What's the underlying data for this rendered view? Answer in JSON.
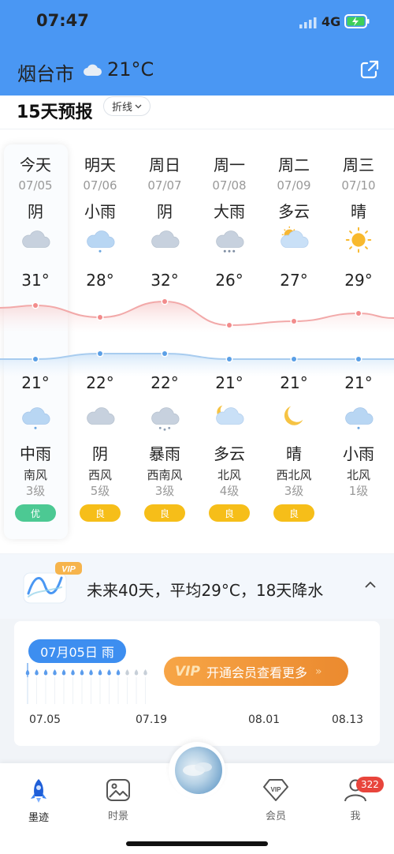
{
  "status_bar": {
    "time": "07:47",
    "network": "4G"
  },
  "header": {
    "city": "烟台市",
    "weather_icon": "cloud-icon",
    "temperature": "21°C"
  },
  "forecast": {
    "title": "15天预报",
    "view_toggle": "折线",
    "days": [
      {
        "day": "今天",
        "date": "07/05",
        "day_condition": "阴",
        "day_icon": "overcast",
        "high": "31°",
        "low": "21°",
        "night_icon": "rain",
        "night_condition": "中雨",
        "wind": "南风",
        "wind_level": "3级",
        "aqi": "优",
        "aqi_color": "#4cc993"
      },
      {
        "day": "明天",
        "date": "07/06",
        "day_condition": "小雨",
        "day_icon": "rain",
        "high": "28°",
        "low": "22°",
        "night_icon": "overcast",
        "night_condition": "阴",
        "wind": "西风",
        "wind_level": "5级",
        "aqi": "良",
        "aqi_color": "#f6be19"
      },
      {
        "day": "周日",
        "date": "07/07",
        "day_condition": "阴",
        "day_icon": "overcast",
        "high": "32°",
        "low": "22°",
        "night_icon": "rainstorm",
        "night_condition": "暴雨",
        "wind": "西南风",
        "wind_level": "3级",
        "aqi": "良",
        "aqi_color": "#f6be19"
      },
      {
        "day": "周一",
        "date": "07/08",
        "day_condition": "大雨",
        "day_icon": "heavy-rain",
        "high": "26°",
        "low": "21°",
        "night_icon": "moon-cloud",
        "night_condition": "多云",
        "wind": "北风",
        "wind_level": "4级",
        "aqi": "良",
        "aqi_color": "#f6be19"
      },
      {
        "day": "周二",
        "date": "07/09",
        "day_condition": "多云",
        "day_icon": "sun-cloud",
        "high": "27°",
        "low": "21°",
        "night_icon": "moon",
        "night_condition": "晴",
        "wind": "西北风",
        "wind_level": "3级",
        "aqi": "良",
        "aqi_color": "#f6be19"
      },
      {
        "day": "周三",
        "date": "07/10",
        "day_condition": "晴",
        "day_icon": "sun",
        "high": "29°",
        "low": "21°",
        "night_icon": "rain",
        "night_condition": "小雨",
        "wind": "北风",
        "wind_level": "1级",
        "aqi": "",
        "aqi_color": ""
      }
    ],
    "high_temps": [
      31,
      28,
      32,
      26,
      27,
      29
    ],
    "low_temps": [
      21,
      22,
      22,
      21,
      21,
      21
    ]
  },
  "forty_day": {
    "vip_tag": "VIP",
    "summary": "未来40天，平均29°C，18天降水",
    "selected_label": "07月05日 雨",
    "vip_button": "开通会员查看更多",
    "vip_button_logo": "VIP",
    "x_labels": [
      "07.05",
      "07.19",
      "08.01",
      "08.13"
    ]
  },
  "nav": {
    "items": [
      {
        "label": "墨迹",
        "icon": "rocket-icon"
      },
      {
        "label": "时景",
        "icon": "photo-icon"
      },
      {
        "label": "会员",
        "icon": "vip-diamond-icon"
      },
      {
        "label": "我",
        "icon": "user-icon"
      }
    ],
    "badge": "322"
  }
}
